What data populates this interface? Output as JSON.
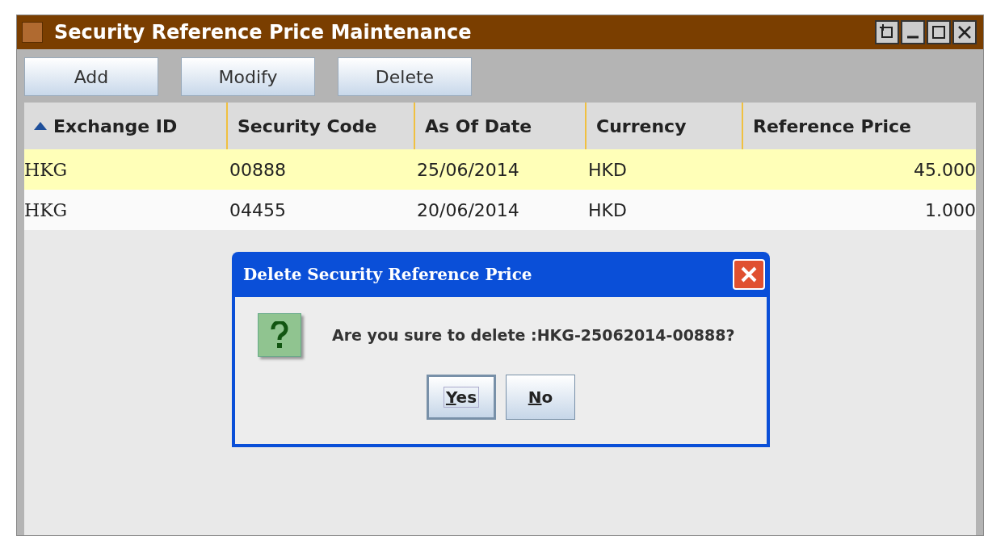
{
  "window": {
    "title": "Security Reference Price Maintenance"
  },
  "toolbar": [
    "Add",
    "Modify",
    "Delete"
  ],
  "table": {
    "columns": [
      {
        "label": "Exchange ID",
        "sorted": true
      },
      {
        "label": "Security Code",
        "sorted": false
      },
      {
        "label": "As Of Date",
        "sorted": false
      },
      {
        "label": "Currency",
        "sorted": false
      },
      {
        "label": "Reference Price",
        "sorted": false
      }
    ],
    "rows": [
      {
        "selected": true,
        "cells": [
          "HKG",
          "00888",
          "25/06/2014",
          "HKD",
          "45.000"
        ]
      },
      {
        "selected": false,
        "cells": [
          "HKG",
          "04455",
          "20/06/2014",
          "HKD",
          "1.000"
        ]
      }
    ]
  },
  "dialog": {
    "title": "Delete Security Reference Price",
    "message": "Are you sure to delete :HKG-25062014-00888?",
    "buttons": [
      {
        "label": "Yes",
        "focused": true
      },
      {
        "label": "No",
        "focused": false
      }
    ]
  }
}
